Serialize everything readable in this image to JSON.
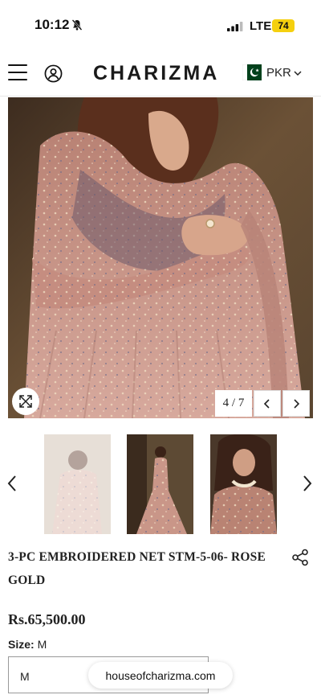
{
  "status_bar": {
    "time": "10:12",
    "network": "LTE",
    "battery": "74"
  },
  "header": {
    "brand": "CHARIZMA",
    "currency": "PKR"
  },
  "gallery": {
    "counter": "4 / 7"
  },
  "product": {
    "title": "3-PC EMBROIDERED NET STM-5-06- ROSE GOLD",
    "price": "Rs.65,500.00",
    "size_label": "Size:",
    "size_value": "M",
    "selected_size": "M"
  },
  "browser": {
    "url": "houseofcharizma.com"
  },
  "colors": {
    "accent_battery": "#f5d00f",
    "flag_green": "#01411c",
    "dress_pink": "#c98a7f"
  }
}
